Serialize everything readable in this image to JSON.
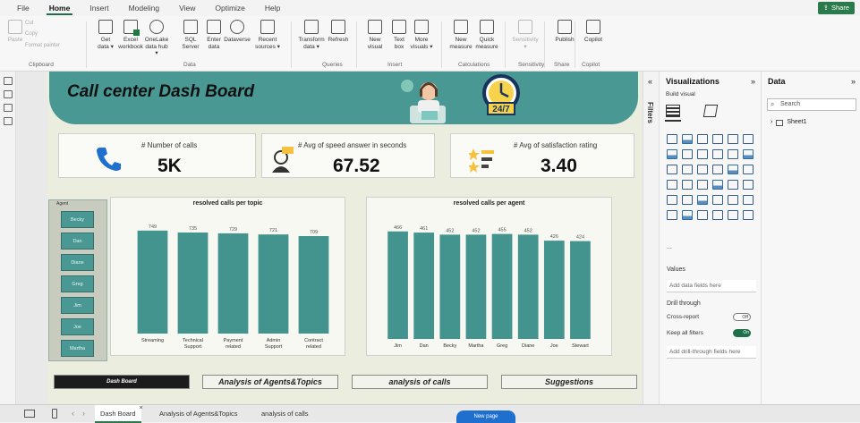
{
  "menu": {
    "tabs": [
      "File",
      "Home",
      "Insert",
      "Modeling",
      "View",
      "Optimize",
      "Help"
    ],
    "active": "Home",
    "share_label": "Share"
  },
  "ribbon": {
    "buttons": [
      {
        "label": "Paste",
        "faded": true
      },
      {
        "label": "Get\ndata ▾"
      },
      {
        "label": "Excel\nworkbook"
      },
      {
        "label": "OneLake\ndata hub ▾"
      },
      {
        "label": "SQL\nServer"
      },
      {
        "label": "Enter\ndata"
      },
      {
        "label": "Dataverse"
      },
      {
        "label": "Recent\nsources ▾"
      },
      {
        "label": "Transform\ndata ▾"
      },
      {
        "label": "Refresh"
      },
      {
        "label": "New\nvisual"
      },
      {
        "label": "Text\nbox"
      },
      {
        "label": "More\nvisuals ▾"
      },
      {
        "label": "New\nmeasure"
      },
      {
        "label": "Quick\nmeasure"
      },
      {
        "label": "Sensitivity\n▾",
        "faded": true
      },
      {
        "label": "Publish"
      },
      {
        "label": "Copilot"
      }
    ],
    "small_items": [
      "Cut",
      "Copy",
      "Format painter"
    ],
    "groups": [
      "Clipboard",
      "Data",
      "Queries",
      "Insert",
      "Calculations",
      "Sensitivity",
      "Share",
      "Copilot"
    ]
  },
  "report": {
    "title": "Call center Dash Board",
    "clock_text": "24/7",
    "kpis": [
      {
        "label": "# Number of calls",
        "value": "5K",
        "icon": "phone-icon"
      },
      {
        "label": "# Avg of speed answer in seconds",
        "value": "67.52",
        "icon": "operator-icon"
      },
      {
        "label": "# Avg of satisfaction rating",
        "value": "3.40",
        "icon": "rating-icon"
      }
    ],
    "slicer": {
      "header": "Agent",
      "items": [
        "Becky",
        "Dan",
        "Diane",
        "Greg",
        "Jim",
        "Joe",
        "Martha"
      ]
    },
    "nav_buttons": [
      "Dash Board",
      "Analysis of Agents&Topics",
      "analysis of calls",
      "Suggestions"
    ]
  },
  "chart_data": [
    {
      "type": "bar",
      "title": "resolved calls per topic",
      "categories": [
        "Streaming",
        "Technical Support",
        "Payment related",
        "Admin Support",
        "Contract related"
      ],
      "values": [
        749,
        735,
        729,
        721,
        709
      ],
      "data_labels": [
        "749",
        "735",
        "729",
        "721",
        "709"
      ],
      "ylim": [
        0,
        800
      ],
      "color": "#43938e"
    },
    {
      "type": "bar",
      "title": "resolved calls per agent",
      "categories": [
        "Jim",
        "Dan",
        "Becky",
        "Martha",
        "Greg",
        "Diane",
        "Joe",
        "Stewart"
      ],
      "values": [
        466,
        461,
        452,
        452,
        455,
        452,
        426,
        424
      ],
      "data_labels": [
        "466",
        "461",
        "452",
        "452",
        "455",
        "452",
        "426",
        "424"
      ],
      "ylim": [
        0,
        500
      ],
      "color": "#43938e"
    }
  ],
  "viz_pane": {
    "title": "Visualizations",
    "build_visual": "Build visual",
    "filters_label": "Filters",
    "values_label": "Values",
    "values_placeholder": "Add data fields here",
    "drill_label": "Drill through",
    "cross_report": "Cross-report",
    "cross_report_state": "Off",
    "keep_filters": "Keep all filters",
    "keep_filters_state": "On",
    "drill_placeholder": "Add drill-through fields here",
    "more": "..."
  },
  "data_pane": {
    "title": "Data",
    "search_placeholder": "Search",
    "tables": [
      "Sheet1"
    ]
  },
  "bottom": {
    "pages": [
      "Dash Board",
      "Analysis of Agents&Topics",
      "analysis of calls"
    ],
    "active": "Dash Board",
    "new_page": "New page"
  },
  "colors": {
    "teal": "#4a9893",
    "bar": "#43938e",
    "brand_green": "#2b7a4b"
  }
}
